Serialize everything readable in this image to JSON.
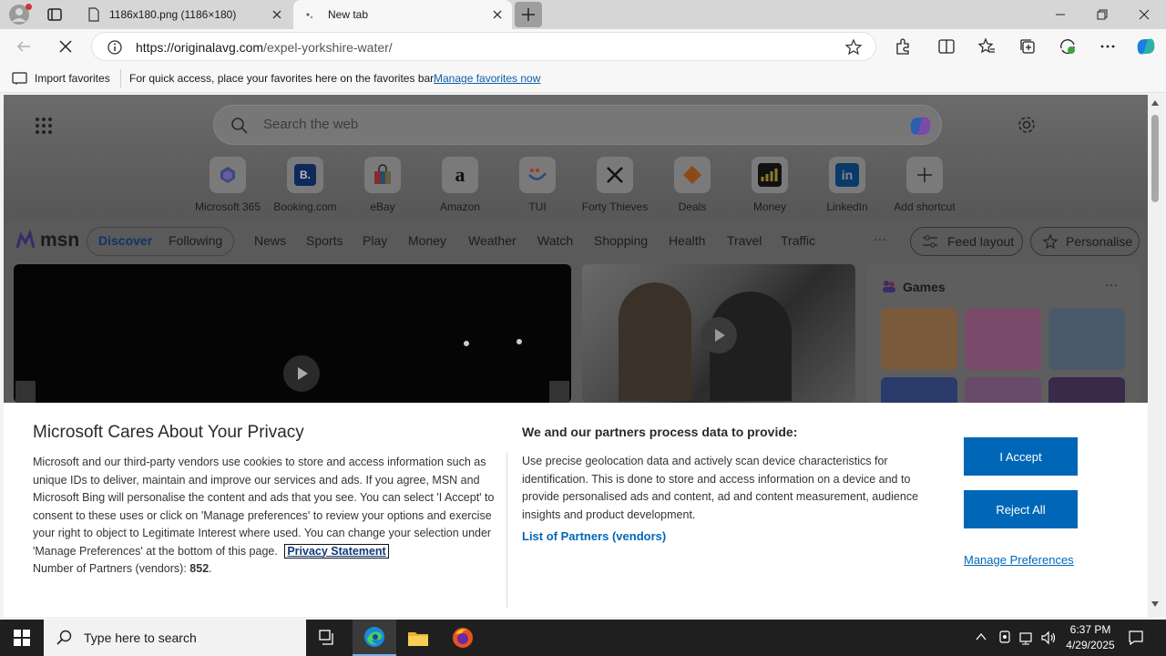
{
  "browser": {
    "tabs": [
      {
        "title": "1186x180.png (1186×180)",
        "active": false
      },
      {
        "title": "New tab",
        "active": true
      }
    ],
    "address": {
      "host": "https://originalavg.com",
      "path": "/expel-yorkshire-water/"
    },
    "favorites_bar": {
      "import_label": "Import favorites",
      "hint": "For quick access, place your favorites here on the favorites bar.",
      "manage_link": "Manage favorites now"
    }
  },
  "newtab": {
    "search_placeholder": "Search the web",
    "shortcuts": [
      {
        "label": "Microsoft 365"
      },
      {
        "label": "Booking.com"
      },
      {
        "label": "eBay"
      },
      {
        "label": "Amazon"
      },
      {
        "label": "TUI"
      },
      {
        "label": "Forty Thieves"
      },
      {
        "label": "Deals"
      },
      {
        "label": "Money"
      },
      {
        "label": "LinkedIn"
      },
      {
        "label": "Add shortcut"
      }
    ],
    "msn": {
      "logo": "msn",
      "tabs": [
        "Discover",
        "Following"
      ],
      "nav": [
        "News",
        "Sports",
        "Play",
        "Money",
        "Weather",
        "Watch",
        "Shopping",
        "Health",
        "Travel",
        "Traffic"
      ],
      "more": "···",
      "feed_layout": "Feed layout",
      "personalise": "Personalise",
      "games_title": "Games",
      "games_more": "···"
    }
  },
  "privacy": {
    "title": "Microsoft Cares About Your Privacy",
    "body": "Microsoft and our third-party vendors use cookies to store and access information such as unique IDs to deliver, maintain and improve our services and ads. If you agree, MSN and Microsoft Bing will personalise the content and ads that you see. You can select 'I Accept' to consent to these uses or click on 'Manage preferences' to review your options and exercise your right to object to Legitimate Interest where used.  You can change your selection under 'Manage Preferences' at the bottom of this page.",
    "privacy_link": "Privacy Statement",
    "partners_label": "Number of Partners (vendors):",
    "partners_count": "852",
    "partners_suffix": ".",
    "process_title": "We and our partners process data to provide:",
    "process_body": "Use precise geolocation data and actively scan device characteristics for identification. This is done to store and access information on a device and to provide personalised ads and content, ad and content measurement, audience insights and product development.",
    "list_link": "List of Partners (vendors)",
    "accept": "I Accept",
    "reject": "Reject All",
    "manage": "Manage Preferences"
  },
  "taskbar": {
    "search_placeholder": "Type here to search",
    "time": "6:37 PM",
    "date": "4/29/2025"
  }
}
